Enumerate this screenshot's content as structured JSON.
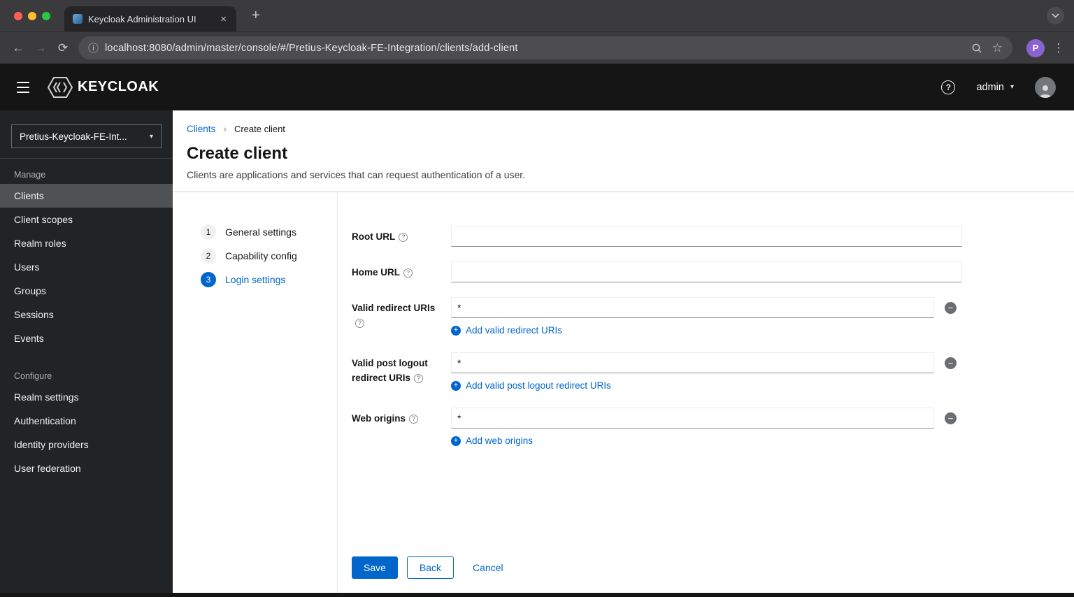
{
  "browser": {
    "tab_title": "Keycloak Administration UI",
    "url": "localhost:8080/admin/master/console/#/Pretius-Keycloak-FE-Integration/clients/add-client",
    "profile_initial": "P"
  },
  "icons": {
    "close": "×",
    "plus": "+",
    "minus": "−",
    "back_arrow": "←",
    "forward_arrow": "→",
    "reload": "⟳",
    "info": "ⓘ",
    "star": "☆",
    "menu_dots": "⋮",
    "caret_down": "▾",
    "breadcrumb_separator": "›",
    "question": "?"
  },
  "masthead": {
    "brand": "KEYCLOAK",
    "user_menu": "admin"
  },
  "sidebar": {
    "realm_selector": "Pretius-Keycloak-FE-Int...",
    "groups": [
      {
        "label": "Manage",
        "items": [
          {
            "label": "Clients"
          },
          {
            "label": "Client scopes"
          },
          {
            "label": "Realm roles"
          },
          {
            "label": "Users"
          },
          {
            "label": "Groups"
          },
          {
            "label": "Sessions"
          },
          {
            "label": "Events"
          }
        ]
      },
      {
        "label": "Configure",
        "items": [
          {
            "label": "Realm settings"
          },
          {
            "label": "Authentication"
          },
          {
            "label": "Identity providers"
          },
          {
            "label": "User federation"
          }
        ]
      }
    ]
  },
  "breadcrumb": {
    "parent": "Clients",
    "current": "Create client"
  },
  "page": {
    "title": "Create client",
    "description": "Clients are applications and services that can request authentication of a user."
  },
  "wizard_steps": [
    {
      "number": "1",
      "label": "General settings"
    },
    {
      "number": "2",
      "label": "Capability config"
    },
    {
      "number": "3",
      "label": "Login settings"
    }
  ],
  "form": {
    "fields": [
      {
        "label": "Root URL",
        "value": ""
      },
      {
        "label": "Home URL",
        "value": ""
      },
      {
        "label": "Valid redirect URIs",
        "value": "*",
        "add_label": "Add valid redirect URIs"
      },
      {
        "label": "Valid post logout redirect URIs",
        "value": "*",
        "add_label": "Add valid post logout redirect URIs"
      },
      {
        "label": "Web origins",
        "value": "*",
        "add_label": "Add web origins"
      }
    ]
  },
  "footer": {
    "save": "Save",
    "back": "Back",
    "cancel": "Cancel"
  },
  "colors": {
    "primary": "#0066cc",
    "masthead": "#151515",
    "sidebar": "#212427",
    "active_nav": "#4f5255"
  }
}
